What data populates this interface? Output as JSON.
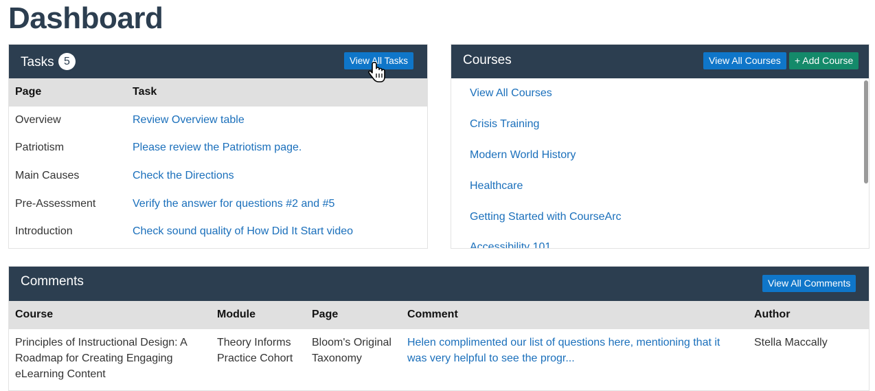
{
  "page": {
    "title": "Dashboard"
  },
  "tasks": {
    "title": "Tasks",
    "count": "5",
    "view_all_label": "View All Tasks",
    "columns": [
      "Page",
      "Task"
    ],
    "rows": [
      {
        "page": "Overview",
        "task": "Review Overview table"
      },
      {
        "page": "Patriotism",
        "task": "Please review the Patriotism page."
      },
      {
        "page": "Main Causes",
        "task": "Check the Directions"
      },
      {
        "page": "Pre-Assessment",
        "task": "Verify the answer for questions #2 and #5"
      },
      {
        "page": "Introduction",
        "task": "Check sound quality of How Did It Start video"
      }
    ]
  },
  "courses": {
    "title": "Courses",
    "view_all_label": "View All Courses",
    "add_label": "+ Add Course",
    "items": [
      "View All Courses",
      "Crisis Training",
      "Modern World History",
      "Healthcare",
      "Getting Started with CourseArc",
      "Accessibility 101"
    ]
  },
  "comments": {
    "title": "Comments",
    "view_all_label": "View All Comments",
    "columns": [
      "Course",
      "Module",
      "Page",
      "Comment",
      "Author"
    ],
    "rows": [
      {
        "course": "Principles of Instructional Design: A Roadmap for Creating Engaging eLearning Content",
        "module": "Theory Informs Practice Cohort",
        "page": "Bloom's Original Taxonomy",
        "comment": "Helen complimented our list of questions here, mentioning that it was very helpful to see the progr...",
        "author": "Stella Maccally"
      }
    ]
  },
  "colors": {
    "header_bg": "#2c3e50",
    "primary_button": "#0f76c9",
    "success_button": "#148a6a",
    "link": "#1a6fbb",
    "table_header_bg": "#e0e0e0"
  },
  "icons": {
    "cursor": "hand-pointer-icon"
  }
}
